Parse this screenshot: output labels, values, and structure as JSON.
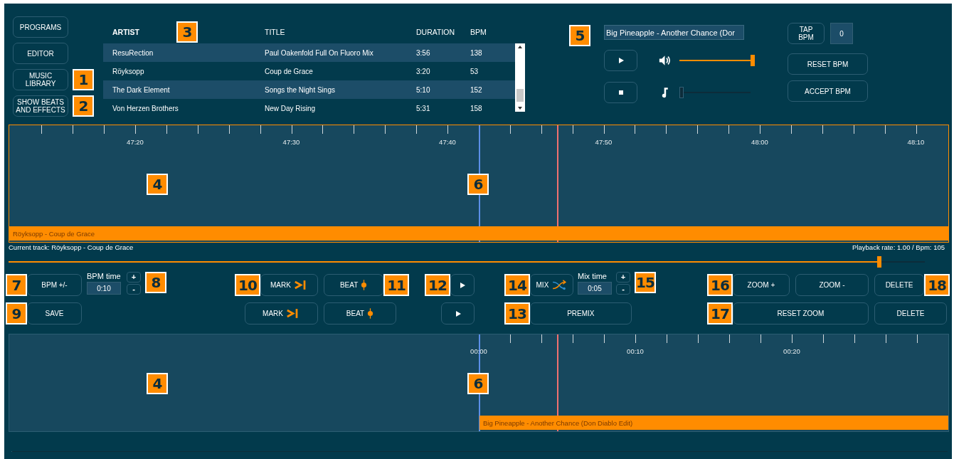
{
  "nav_buttons": [
    {
      "label": "PROGRAMS"
    },
    {
      "label": "EDITOR"
    },
    {
      "label": "MUSIC LIBRARY",
      "callout": "1"
    },
    {
      "label": "SHOW BEATS AND EFFECTS",
      "callout": "2"
    }
  ],
  "library": {
    "callout": "3",
    "columns": [
      "ARTIST",
      "TITLE",
      "DURATION",
      "BPM"
    ],
    "rows": [
      {
        "artist": "ResuRection",
        "title": "Paul Oakenfold Full On Fluoro Mix",
        "duration": "3:56",
        "bpm": "138"
      },
      {
        "artist": "Röyksopp",
        "title": "Coup de Grace",
        "duration": "3:20",
        "bpm": "53"
      },
      {
        "artist": "The Dark Element",
        "title": "Songs the Night Sings",
        "duration": "5:10",
        "bpm": "152"
      },
      {
        "artist": "Von Herzen Brothers",
        "title": "New Day Rising",
        "duration": "5:31",
        "bpm": "158"
      }
    ]
  },
  "player": {
    "callout": "5",
    "track_field": {
      "value": "Big Pineapple - Another Chance (Dor"
    },
    "volume": {
      "level": 1
    },
    "pitch": {
      "level": 0
    },
    "tap_bpm": "TAP BPM",
    "tap_count": "0",
    "reset_bpm": "RESET BPM",
    "accept_bpm": "ACCEPT BPM"
  },
  "timeline_top": {
    "ticks": [
      "47:20",
      "47:30",
      "47:40",
      "47:50",
      "48:00",
      "48:10"
    ],
    "clip": "Röyksopp - Coup de Grace",
    "callouts": [
      "4",
      "6"
    ]
  },
  "status": {
    "current_track": "Current track: Röyksopp - Coup de Grace",
    "playback": "Playback rate: 1.00 / Bpm: 105"
  },
  "position_slider": {
    "level": 0.95
  },
  "controls": {
    "bpm_adjust": {
      "label": "BPM +/-",
      "callout": "7"
    },
    "bpm_time": {
      "label": "BPM time",
      "value": "0:10",
      "plus": "+",
      "minus": "-",
      "callout": "8"
    },
    "save": {
      "label": "SAVE",
      "callout": "9"
    },
    "marks": [
      {
        "label": "MARK",
        "callout": "10"
      },
      {
        "label": "MARK"
      }
    ],
    "beats": [
      {
        "label": "BEAT",
        "callout": "11"
      },
      {
        "label": "BEAT"
      }
    ],
    "play": {
      "callout": "12"
    },
    "mix": {
      "label": "MIX",
      "callout": "14"
    },
    "mix_time": {
      "label": "Mix time",
      "value": "0:05",
      "plus": "+",
      "minus": "-",
      "callout": "15"
    },
    "premix": {
      "label": "PREMIX",
      "callout": "13"
    },
    "zoom_in": {
      "label": "ZOOM +",
      "callout": "16"
    },
    "zoom_out": {
      "label": "ZOOM -"
    },
    "deletes": [
      {
        "label": "DELETE",
        "callout": "18"
      },
      {
        "label": "DELETE"
      }
    ],
    "reset_zoom": {
      "label": "RESET ZOOM",
      "callout": "17"
    }
  },
  "timeline_bottom": {
    "ticks": [
      "00:00",
      "00:10",
      "00:20"
    ],
    "clip": "Big Pineapple - Another Chance (Don Diablo Edit)",
    "callouts": [
      "4",
      "6"
    ]
  }
}
